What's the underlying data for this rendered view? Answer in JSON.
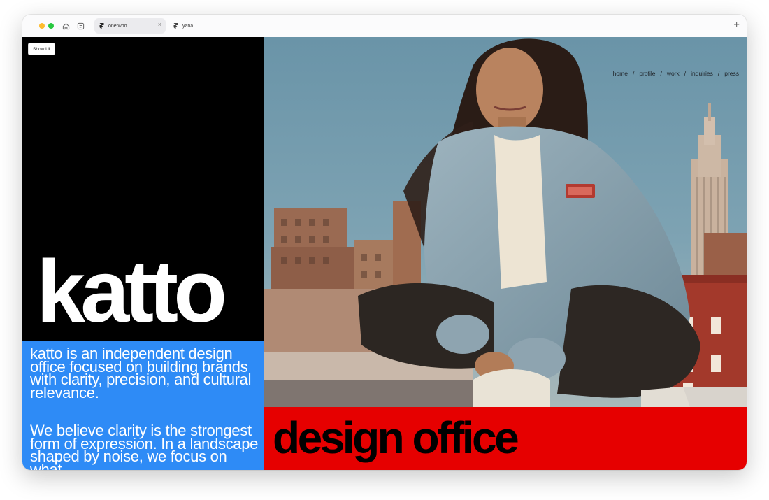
{
  "browser": {
    "tabs": [
      {
        "label": "onetwoo",
        "active": true
      },
      {
        "label": "yanā",
        "active": false
      }
    ],
    "new_tab": "+",
    "close_tab": "×"
  },
  "site": {
    "show_ui_label": "Show UI",
    "brand": "katto",
    "nav": [
      "home",
      "profile",
      "work",
      "inquiries",
      "press"
    ],
    "nav_separator": "/",
    "intro": "katto is an independent design office focused on building brands with clarity, precision, and cultural relevance.",
    "belief": "We believe clarity is the strongest form of expression. In a landscape shaped by noise, we focus on what",
    "tagline": "design office",
    "colors": {
      "black_panel": "#000000",
      "blue_panel": "#2e8bf6",
      "red_banner": "#e60000"
    }
  }
}
